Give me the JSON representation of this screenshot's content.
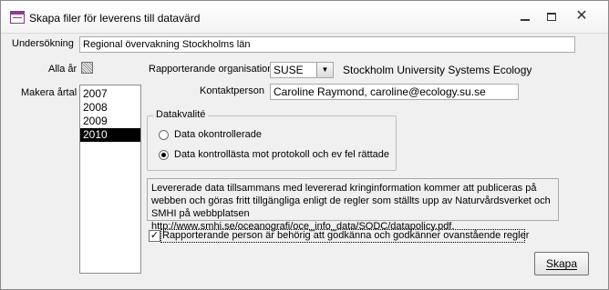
{
  "window": {
    "title": "Skapa filer för leverens till datavärd",
    "minimize_label": "—",
    "close_label": "✕"
  },
  "undersokning": {
    "label": "Undersökning",
    "value": "Regional övervakning Stockholms län"
  },
  "alla_ar": {
    "label": "Alla år",
    "checked": false
  },
  "makera_artal": {
    "label": "Makera årtal",
    "items": [
      "2007",
      "2008",
      "2009",
      "2010"
    ],
    "selected": "2010"
  },
  "organisation": {
    "label": "Rapporterande organisation",
    "code": "SUSE",
    "name": "Stockholm University Systems Ecology",
    "dropdown_icon": "▼"
  },
  "kontaktperson": {
    "label": "Kontaktperson",
    "value": "Caroline Raymond, caroline@ecology.su.se"
  },
  "datakvalite": {
    "legend": "Datakvalité",
    "options": [
      {
        "label": "Data okontrollerade",
        "selected": false
      },
      {
        "label": "Data kontrollästa mot protokoll och ev fel rättade",
        "selected": true
      }
    ]
  },
  "info": {
    "text": "Levererade data tillsammans med levererad kringinformation kommer att publiceras på webben och göras fritt tillgängliga enligt de regler som ställts upp av Naturvårdsverket och SMHI på webbplatsen http://www.smhi.se/oceanografi/oce_info_data/SODC/datapolicy.pdf."
  },
  "godkann": {
    "label": "Rapporterande person är behörig att godkänna och godkänner ovanstående regler",
    "checked": true,
    "check_mark": "✓"
  },
  "skapa_button": {
    "label": "Skapa"
  }
}
